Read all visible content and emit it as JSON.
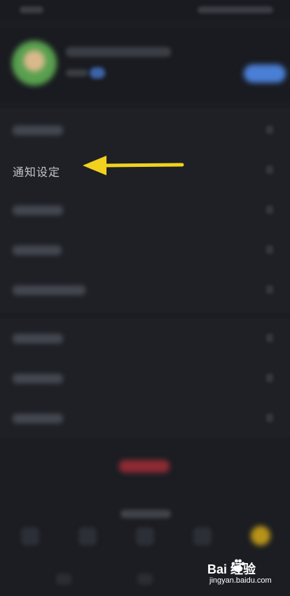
{
  "settings": {
    "notification_label": "通知设定"
  },
  "watermark": {
    "brand": "Bai  经验",
    "url": "jingyan.baidu.com"
  },
  "colors": {
    "background": "#1b1d22",
    "arrow": "#f2d21e",
    "logout": "#8e2b34",
    "primary_button": "#4a7fd6"
  },
  "icons": [
    "arrow-left-icon",
    "chevron-right-icon",
    "baidu-paw-icon"
  ]
}
